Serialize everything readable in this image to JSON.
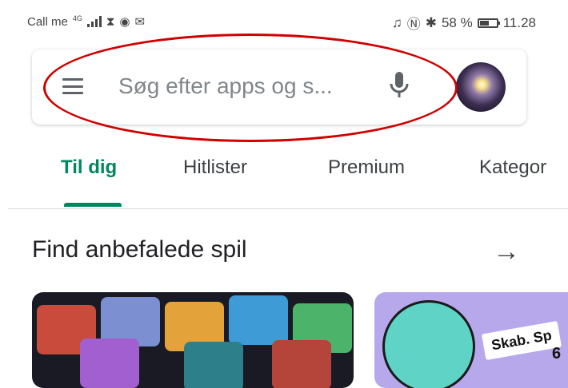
{
  "status_bar": {
    "carrier": "Call me",
    "network_tag": "4G",
    "battery_percent": "58 %",
    "time": "11.28",
    "battery_level": 0.58
  },
  "search": {
    "placeholder": "Søg efter apps og s...",
    "menu_icon": "hamburger-menu-icon",
    "mic_icon": "microphone-icon",
    "avatar_icon": "profile-avatar"
  },
  "tabs": [
    {
      "label": "Til dig",
      "active": true
    },
    {
      "label": "Hitlister",
      "active": false
    },
    {
      "label": "Premium",
      "active": false
    },
    {
      "label": "Kategor",
      "active": false
    }
  ],
  "section": {
    "title": "Find anbefalede spil",
    "arrow_icon": "arrow-right-icon"
  },
  "cards": {
    "card_2_badge": "Skab. Sp",
    "card_2_badge_num": "6"
  },
  "colors": {
    "accent": "#01875f",
    "annotation": "#d00000"
  }
}
